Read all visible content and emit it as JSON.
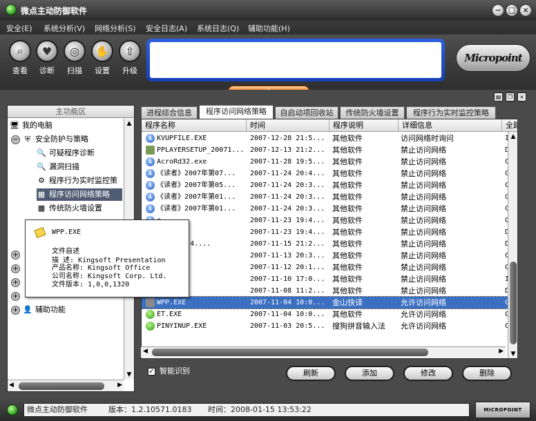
{
  "window": {
    "title": "微点主动防御软件"
  },
  "menu": [
    "安全(E)",
    "系统分析(V)",
    "网络分析(S)",
    "安全日志(A)",
    "系统日志(Q)",
    "辅助功能(H)"
  ],
  "toolbar": [
    {
      "label": "查看",
      "icon": "magnifier-icon"
    },
    {
      "label": "诊断",
      "icon": "heart-icon"
    },
    {
      "label": "扫描",
      "icon": "scan-icon"
    },
    {
      "label": "设置",
      "icon": "hand-icon"
    },
    {
      "label": "升级",
      "icon": "upgrade-icon"
    }
  ],
  "logo": {
    "text": "Micropoint"
  },
  "leftpanel": {
    "title": "主功能区",
    "items": [
      {
        "label": "我的电脑"
      },
      {
        "label": "安全防护与策略"
      },
      {
        "label": "可疑程序诊断"
      },
      {
        "label": "漏洞扫描"
      },
      {
        "label": "程序行为实时监控策"
      },
      {
        "label": "程序访问网络策略"
      },
      {
        "label": "传统防火墙设置"
      },
      {
        "label": "辅助功能"
      }
    ]
  },
  "tooltip": {
    "title": "WPP.EXE",
    "line1": "文件自述",
    "line2": "描    述: Kingsoft Presentation",
    "line3": "产品名称: Kingsoft Office",
    "line4": "公司名称: Kingsoft Corp. Ltd.",
    "line5": "文件版本: 1,0,0,1320"
  },
  "tabs": [
    "进程综合信息",
    "程序访问网络策略",
    "自启动项回收站",
    "传统防火墙设置",
    "程序行为实时监控策略"
  ],
  "table": {
    "headers": [
      "程序名称",
      "时间",
      "程序说明",
      "详细信息",
      "全路"
    ],
    "rows": [
      [
        "KVUPFILE.EXE",
        "2007-12-28 21:5...",
        "其他软件",
        "访问网络时询问",
        "I:\\"
      ],
      [
        "PPLAYERSETUP_20071...",
        "2007-12-13 21:2...",
        "其他软件",
        "禁止访问网络",
        "D:\\"
      ],
      [
        "AcroRd32.exe",
        "2007-11-28 19:5...",
        "其他软件",
        "禁止访问网络",
        "C:\\"
      ],
      [
        "《读者》2007年第07...",
        "2007-11-24 20:4...",
        "其他软件",
        "禁止访问网络",
        "C:\\"
      ],
      [
        "《读者》2007年第05...",
        "2007-11-24 20:3...",
        "其他软件",
        "禁止访问网络",
        "C:\\"
      ],
      [
        "《读者》2007年第01...",
        "2007-11-24 20:3...",
        "其他软件",
        "禁止访问网络",
        "C:\\"
      ],
      [
        "《读者》2007年第01...",
        "2007-11-24 20:3...",
        "其他软件",
        "禁止访问网络",
        "C:\\"
      ],
      [
        "e",
        "2007-11-23 19:4...",
        "其他软件",
        "禁止访问网络",
        "C:\\"
      ],
      [
        "EXE",
        "2007-11-23 19:4...",
        "其他软件",
        "禁止访问网络",
        "D:\\"
      ],
      [
        "ETUP1.2.4....",
        "2007-11-15 21:2...",
        "其他软件",
        "禁止访问网络",
        "D:\\"
      ],
      [
        "EXE",
        "2007-11-13 20:3...",
        "其他软件",
        "禁止访问网络",
        "C:\\"
      ],
      [
        "ER.EXE",
        "2007-11-12 20:1...",
        "其他软件",
        "禁止访问网络",
        "C:\\"
      ],
      [
        "ER.EXE",
        "2007-11-10 17:0...",
        "其他软件",
        "禁止访问网络",
        "I:\\"
      ],
      [
        "ADE.EXE",
        "2007-11-08 11:2...",
        "其他软件",
        "禁止访问网络",
        "D:\\"
      ],
      [
        "WPP.EXE",
        "2007-11-04 10:0...",
        "金山快译",
        "允许访问网络",
        "C:\\"
      ],
      [
        "ET.EXE",
        "2007-11-04 10:0...",
        "其他软件",
        "允许访问网络",
        "C:\\"
      ],
      [
        "PINYINUP.EXE",
        "2007-11-03 20:5...",
        "搜狗拼音输入法",
        "允许访问网络",
        "C:\\"
      ]
    ]
  },
  "smart": {
    "label": "智能识别"
  },
  "actions": [
    "刷新",
    "添加",
    "修改",
    "删除"
  ],
  "status": {
    "app": "微点主动防御软件",
    "version": "版本：1.2.10571.0183",
    "time": "时间：2008-01-15 13:53:22",
    "brand": "MICROPOINT"
  }
}
